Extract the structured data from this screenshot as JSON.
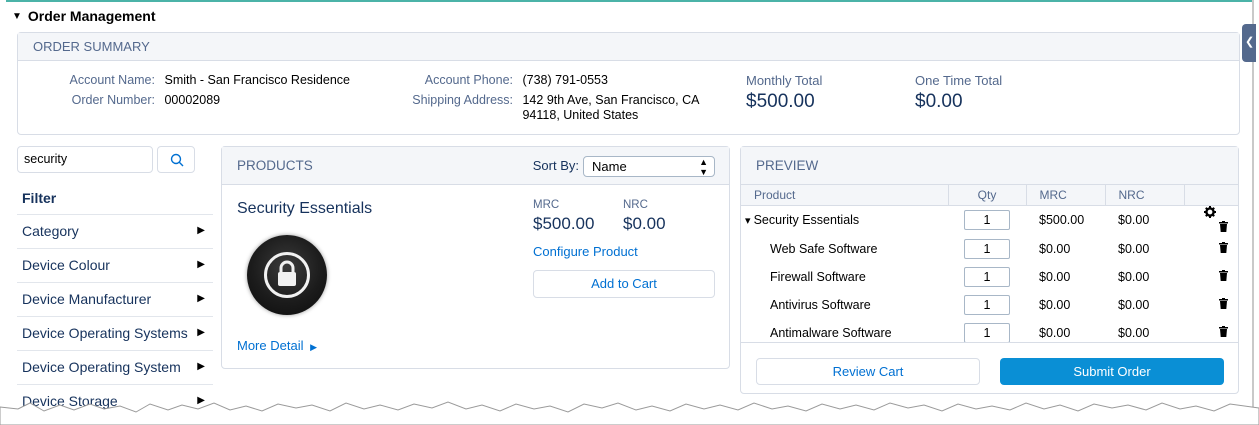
{
  "section": {
    "title": "Order Management"
  },
  "summary": {
    "header": "ORDER SUMMARY",
    "account_name_label": "Account Name:",
    "account_name": "Smith - San Francisco Residence",
    "order_number_label": "Order Number:",
    "order_number": "00002089",
    "account_phone_label": "Account Phone:",
    "account_phone": "(738) 791-0553",
    "shipping_label": "Shipping Address:",
    "shipping_line1": "142 9th Ave, San Francisco, CA",
    "shipping_line2": "94118, United States",
    "monthly_label": "Monthly Total",
    "monthly_value": "$500.00",
    "onetime_label": "One Time Total",
    "onetime_value": "$0.00"
  },
  "search": {
    "value": "security"
  },
  "filter": {
    "title": "Filter",
    "items": [
      {
        "label": "Category"
      },
      {
        "label": "Device Colour"
      },
      {
        "label": "Device Manufacturer"
      },
      {
        "label": "Device Operating Systems"
      },
      {
        "label": "Device Operating System"
      },
      {
        "label": "Device Storage"
      }
    ]
  },
  "products": {
    "header": "PRODUCTS",
    "sort_label": "Sort By:",
    "sort_value": "Name",
    "item": {
      "name": "Security Essentials",
      "mrc_label": "MRC",
      "mrc_value": "$500.00",
      "nrc_label": "NRC",
      "nrc_value": "$0.00",
      "configure_label": "Configure Product",
      "add_to_cart_label": "Add to Cart",
      "more_detail_label": "More Detail"
    }
  },
  "preview": {
    "header": "PREVIEW",
    "columns": [
      "Product",
      "Qty",
      "MRC",
      "NRC"
    ],
    "rows": [
      {
        "product": "Security Essentials",
        "qty": "1",
        "mrc": "$500.00",
        "nrc": "$0.00"
      },
      {
        "product": "Web Safe Software",
        "qty": "1",
        "mrc": "$0.00",
        "nrc": "$0.00"
      },
      {
        "product": "Firewall Software",
        "qty": "1",
        "mrc": "$0.00",
        "nrc": "$0.00"
      },
      {
        "product": "Antivirus Software",
        "qty": "1",
        "mrc": "$0.00",
        "nrc": "$0.00"
      },
      {
        "product": "Antimalware Software",
        "qty": "1",
        "mrc": "$0.00",
        "nrc": "$0.00"
      }
    ],
    "review_label": "Review Cart",
    "submit_label": "Submit Order"
  },
  "icons": {
    "search": "search-icon",
    "lock": "lock-icon",
    "gear": "gear-icon",
    "trash": "trash-icon"
  },
  "colors": {
    "link": "#0070d2",
    "primary_button": "#0a8fd5",
    "header_bg": "#f4f6f9",
    "text": "#16325c"
  }
}
